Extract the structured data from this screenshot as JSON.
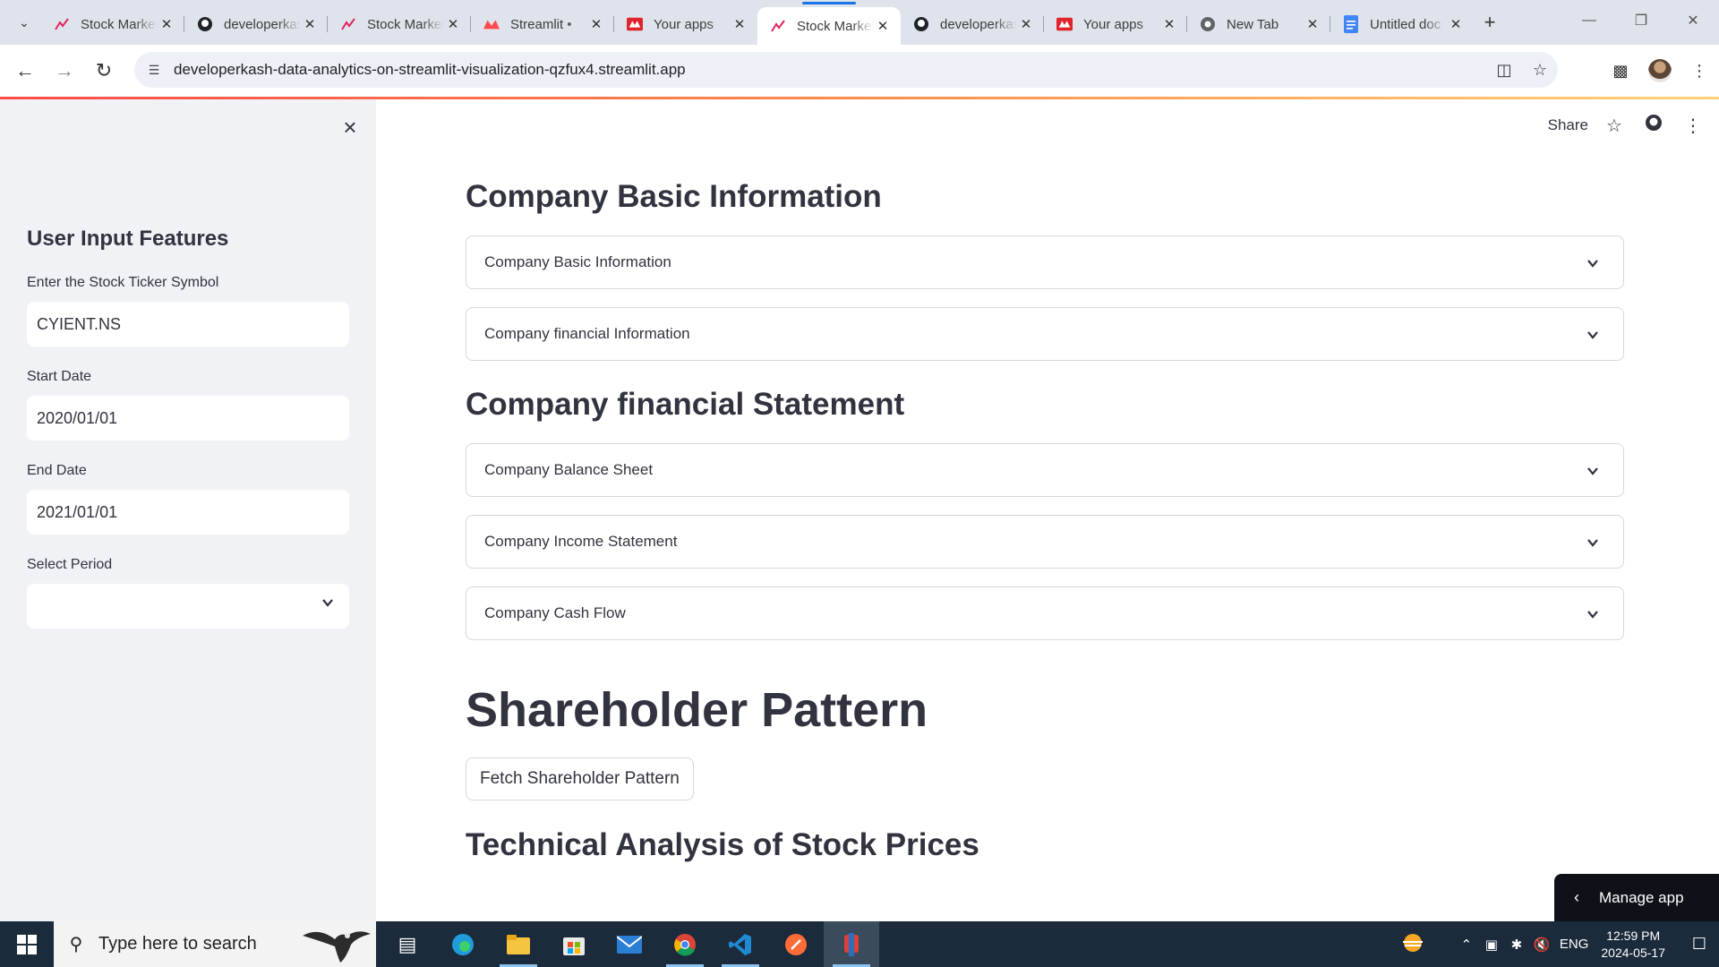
{
  "browser": {
    "tabs": [
      {
        "title": "Stock Market",
        "favicon": "trend-icon"
      },
      {
        "title": "developerkash",
        "favicon": "github-icon"
      },
      {
        "title": "Stock Market",
        "favicon": "trend-icon"
      },
      {
        "title": "Streamlit • ",
        "favicon": "streamlit-icon"
      },
      {
        "title": "Your apps",
        "favicon": "streamlit-icon"
      },
      {
        "title": "Stock Market",
        "favicon": "trend-icon",
        "active": true
      },
      {
        "title": "developerkash",
        "favicon": "github-icon"
      },
      {
        "title": "Your apps",
        "favicon": "streamlit-icon"
      },
      {
        "title": "New Tab",
        "favicon": "chrome-icon"
      },
      {
        "title": "Untitled doc",
        "favicon": "docs-icon"
      }
    ],
    "url": "developerkash-data-analytics-on-streamlit-visualization-qzfux4.streamlit.app"
  },
  "sidebar": {
    "title": "User Input Features",
    "ticker_label": "Enter the Stock Ticker Symbol",
    "ticker_value": "CYIENT.NS",
    "start_label": "Start Date",
    "start_value": "2020/01/01",
    "end_label": "End Date",
    "end_value": "2021/01/01",
    "period_label": "Select Period",
    "period_value": ""
  },
  "header": {
    "share": "Share"
  },
  "main": {
    "section1_title": "Company Basic Information",
    "expander_basic": "Company Basic Information",
    "expander_financial": "Company financial Information",
    "section2_title": "Company financial Statement",
    "expander_balance": "Company Balance Sheet",
    "expander_income": "Company Income Statement",
    "expander_cashflow": "Company Cash Flow",
    "section3_title": "Shareholder Pattern",
    "fetch_button": "Fetch Shareholder Pattern",
    "section4_title": "Technical Analysis of Stock Prices"
  },
  "manage_app": "Manage app",
  "taskbar": {
    "search_placeholder": "Type here to search",
    "language": "ENG",
    "time": "12:59 PM",
    "date": "2024-05-17"
  },
  "colors": {
    "accent": "#ff4b4b",
    "sidebar_bg": "#f0f2f6",
    "text": "#31333f"
  }
}
